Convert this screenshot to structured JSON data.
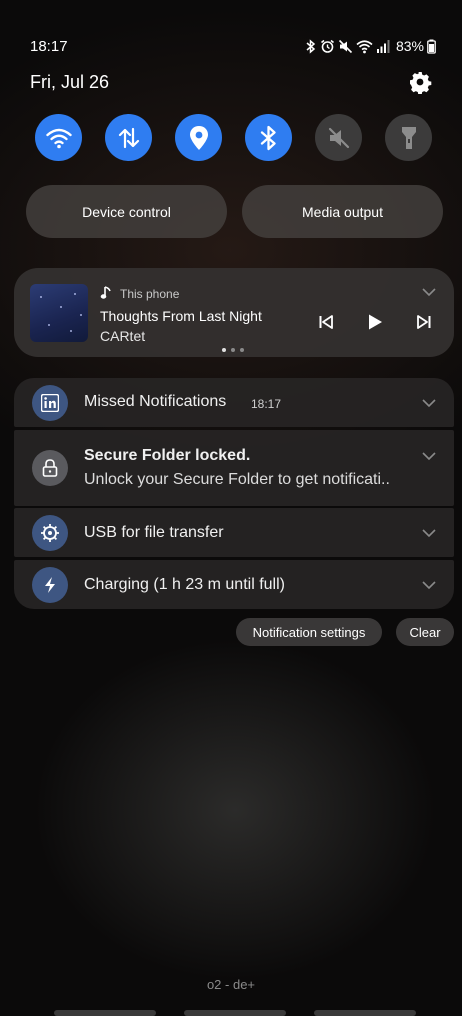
{
  "status_bar": {
    "time": "18:17",
    "battery": "83%"
  },
  "header": {
    "date": "Fri, Jul 26"
  },
  "quick_settings": [
    {
      "name": "wifi",
      "icon": "wifi-icon",
      "active": true
    },
    {
      "name": "mobile-data",
      "icon": "data-arrows-icon",
      "active": true
    },
    {
      "name": "location",
      "icon": "location-pin-icon",
      "active": true
    },
    {
      "name": "bluetooth",
      "icon": "bluetooth-icon",
      "active": true
    },
    {
      "name": "sound",
      "icon": "mute-icon",
      "active": false
    },
    {
      "name": "flashlight",
      "icon": "flashlight-icon",
      "active": false
    }
  ],
  "buttons": {
    "device_control": "Device control",
    "media_output": "Media output"
  },
  "media": {
    "source": "This phone",
    "title": "Thoughts From Last Night",
    "artist": "CARtet"
  },
  "notifications": {
    "linkedin": {
      "title": "Missed Notifications",
      "time": "18:17"
    },
    "secure_folder": {
      "title": "Secure Folder locked.",
      "text": "Unlock your Secure Folder to get notificati.."
    },
    "usb": {
      "title": "USB for file transfer"
    },
    "charging": {
      "title": "Charging (1 h 23 m until full)"
    }
  },
  "actions": {
    "settings": "Notification settings",
    "clear": "Clear"
  },
  "carrier": "o2 - de+",
  "colors": {
    "accent": "#2f7df1",
    "inactive": "#3c3b3b"
  }
}
